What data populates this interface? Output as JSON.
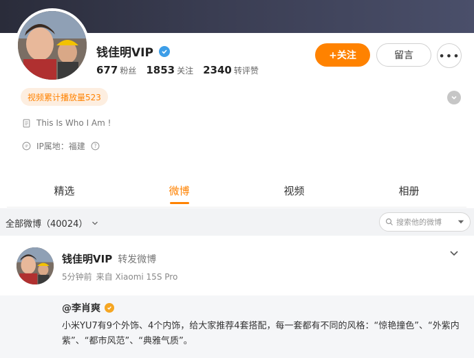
{
  "profile": {
    "name": "钱佳明VIP",
    "stats": [
      {
        "num": "677",
        "label": "粉丝"
      },
      {
        "num": "1853",
        "label": "关注"
      },
      {
        "num": "2340",
        "label": "转评赞"
      }
    ],
    "follow_label": "+关注",
    "message_label": "留言",
    "more_label": "•••",
    "play_badge": "视频累计播放量523",
    "description": "This Is Who I Am !",
    "ip_location": "IP属地：福建"
  },
  "tabs": [
    {
      "label": "精选"
    },
    {
      "label": "微博"
    },
    {
      "label": "视频"
    },
    {
      "label": "相册"
    }
  ],
  "filter": {
    "label": "全部微博（40024）",
    "search_placeholder": "搜索他的微博"
  },
  "post": {
    "author": "钱佳明VIP",
    "action": "转发微博",
    "time": "5分钟前",
    "source": "来自 Xiaomi 15S Pro",
    "original_author": "@李肖爽",
    "original_text": "小米YU7有9个外饰、4个内饰，给大家推荐4套搭配，每一套都有不同的风格：“惊艳撞色”、“外紫内紫”、“都市风范”、“典雅气质”。"
  },
  "colors": {
    "accent": "#ff8200",
    "verified_blue": "#3d9ee8",
    "gold_badge": "#f5a623"
  }
}
